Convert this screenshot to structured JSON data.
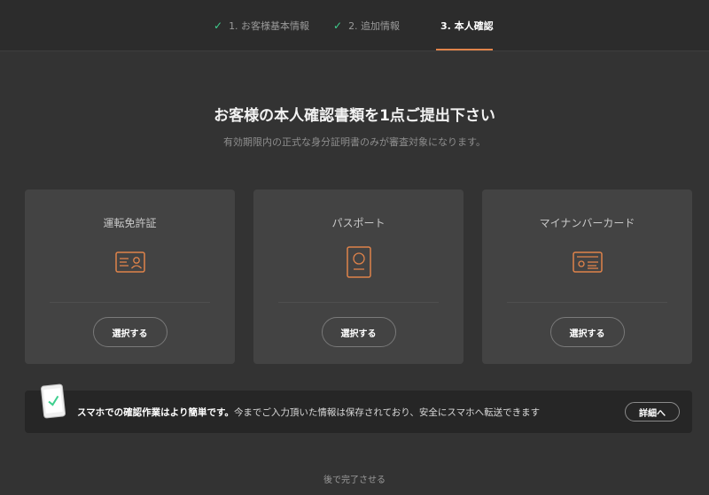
{
  "steps": [
    {
      "label": "1. お客様基本情報",
      "done": true
    },
    {
      "label": "2. 追加情報",
      "done": true
    },
    {
      "label": "3. 本人確認",
      "done": false,
      "active": true
    }
  ],
  "heading": {
    "title": "お客様の本人確認書類を1点ご提出下さい",
    "subtitle": "有効期限内の正式な身分証明書のみが審査対象になります。"
  },
  "documents": [
    {
      "label": "運転免許証",
      "icon": "drivers-license-icon",
      "button": "選択する"
    },
    {
      "label": "パスポート",
      "icon": "passport-icon",
      "button": "選択する"
    },
    {
      "label": "マイナンバーカード",
      "icon": "id-card-icon",
      "button": "選択する"
    }
  ],
  "banner": {
    "icon": "smartphone-check-icon",
    "strong_text": "スマホでの確認作業はより簡単です。",
    "text": "今までご入力頂いた情報は保存されており、安全にスマホへ転送できます",
    "button": "詳細へ"
  },
  "footer": {
    "later_link": "後で完了させる"
  },
  "colors": {
    "accent": "#e0834a",
    "check": "#3ecf8e",
    "background": "#333333",
    "card": "#434343"
  }
}
